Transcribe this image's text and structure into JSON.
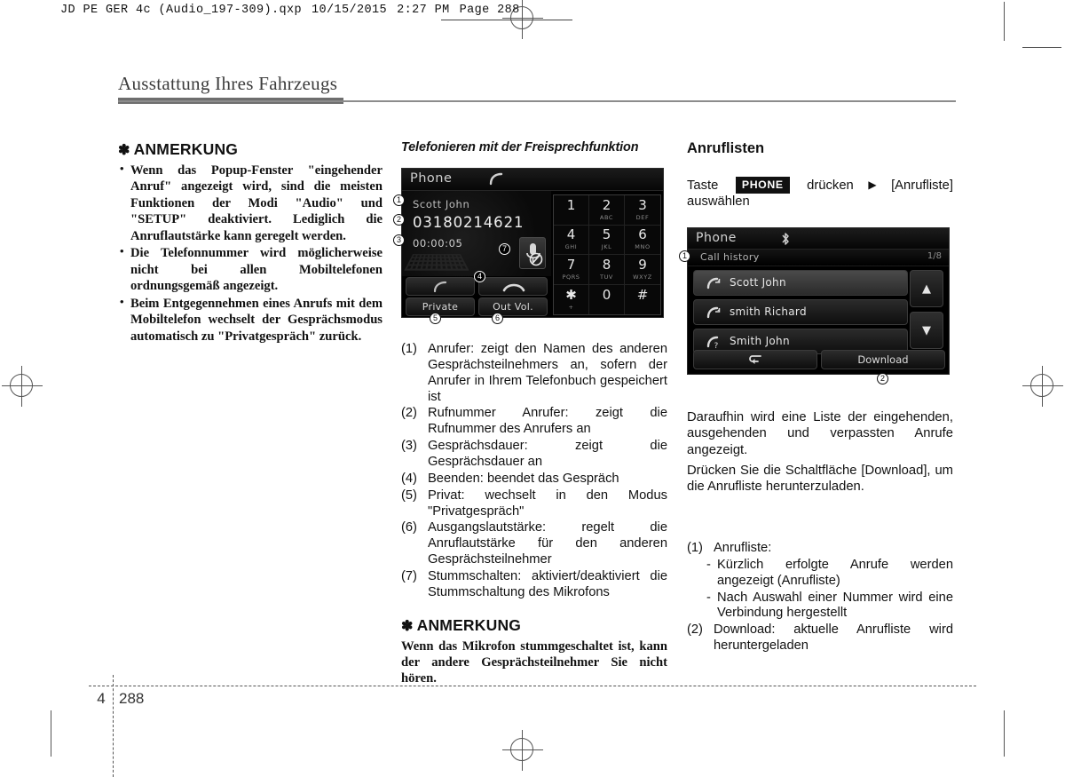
{
  "print_header": {
    "file": "JD PE GER 4c (Audio_197-309).qxp",
    "date": "10/15/2015",
    "time": "2:27 PM",
    "page_label": "Page 288"
  },
  "chapter": {
    "title": "Ausstattung Ihres Fahrzeugs"
  },
  "footer": {
    "chapter_number": "4",
    "page_number": "288"
  },
  "left_column": {
    "note_title": "ANMERKUNG",
    "asterisk": "✽",
    "bullets": [
      "Wenn das Popup-Fenster \"eingehender Anruf\" angezeigt wird, sind die meisten Funktionen der Modi \"Audio\" und \"SETUP\" deaktiviert. Lediglich die Anruflautstärke kann geregelt werden.",
      "Die Telefonnummer wird möglicherweise nicht bei allen Mobiltelefonen ordnungsgemäß angezeigt.",
      "Beim Entgegennehmen eines Anrufs mit dem Mobiltelefon wechselt der Gesprächsmodus automatisch zu \"Privatgespräch\" zurück."
    ]
  },
  "middle_column": {
    "caption": "Telefonieren mit der Freisprechfunktion",
    "call_screen": {
      "title": "Phone",
      "handset_icon": "handset-icon",
      "caller_name": "Scott John",
      "caller_number": "03180214621",
      "call_duration": "00:00:05",
      "buttons": {
        "answer_label": "",
        "end_label": "",
        "private_label": "Private",
        "out_vol_label": "Out Vol."
      },
      "keypad": [
        {
          "digit": "1",
          "sub": ""
        },
        {
          "digit": "2",
          "sub": "ABC"
        },
        {
          "digit": "3",
          "sub": "DEF"
        },
        {
          "digit": "4",
          "sub": "GHI"
        },
        {
          "digit": "5",
          "sub": "JKL"
        },
        {
          "digit": "6",
          "sub": "MNO"
        },
        {
          "digit": "7",
          "sub": "PQRS"
        },
        {
          "digit": "8",
          "sub": "TUV"
        },
        {
          "digit": "9",
          "sub": "WXYZ"
        },
        {
          "digit": "✱",
          "sub": "+"
        },
        {
          "digit": "0",
          "sub": ""
        },
        {
          "digit": "#",
          "sub": ""
        }
      ],
      "callouts": [
        "1",
        "2",
        "3",
        "4",
        "5",
        "6",
        "7"
      ]
    },
    "legend": [
      {
        "num": "(1)",
        "text": "Anrufer: zeigt den Namen des anderen Gesprächsteilnehmers an, sofern der Anrufer in Ihrem Telefonbuch gespeichert ist"
      },
      {
        "num": "(2)",
        "text": "Rufnummer Anrufer: zeigt die Rufnummer des Anrufers an"
      },
      {
        "num": "(3)",
        "text": "Gesprächsdauer: zeigt die Gesprächsdauer an"
      },
      {
        "num": "(4)",
        "text": "Beenden: beendet das Gespräch"
      },
      {
        "num": "(5)",
        "text": "Privat: wechselt in den Modus \"Privatgespräch\""
      },
      {
        "num": "(6)",
        "text": "Ausgangslautstärke: regelt die Anruflautstärke für den anderen Gesprächsteilnehmer"
      },
      {
        "num": "(7)",
        "text": "Stummschalten: aktiviert/deaktiviert die Stummschaltung des Mikrofons"
      }
    ],
    "note_title": "ANMERKUNG",
    "asterisk": "✽",
    "note_text": "Wenn das Mikrofon stummgeschaltet ist, kann der andere Gesprächsteilnehmer Sie nicht hören."
  },
  "right_column": {
    "heading": "Anruflisten",
    "instruction_pre": "Taste",
    "instruction_key": "PHONE",
    "instruction_mid": "drücken",
    "instruction_arrow": "▶",
    "instruction_post": "[Anrufliste] auswählen",
    "history_screen": {
      "title": "Phone",
      "bluetooth_icon": "bluetooth-icon",
      "subtitle": "Call history",
      "page_indicator": "1/8",
      "rows": [
        {
          "name": "Scott John",
          "call_type": "incoming-call-icon",
          "selected": true
        },
        {
          "name": "smith Richard",
          "call_type": "outgoing-call-icon",
          "selected": false
        },
        {
          "name": "Smith John",
          "call_type": "missed-call-icon",
          "selected": false
        }
      ],
      "scroll_up": "▲",
      "scroll_down": "▼",
      "back_label": "↰",
      "download_label": "Download",
      "callouts": [
        "1",
        "2"
      ]
    },
    "paragraphs": [
      "Daraufhin wird eine Liste der eingehenden, ausgehenden und verpassten Anrufe angezeigt.",
      "Drücken Sie die Schaltfläche [Download], um die Anrufliste herunterzuladen."
    ],
    "legend": [
      {
        "num": "(1)",
        "text": "Anrufliste:",
        "subs": [
          "Kürzlich erfolgte Anrufe werden angezeigt (Anrufliste)",
          "Nach Auswahl einer Nummer wird eine Verbindung hergestellt"
        ]
      },
      {
        "num": "(2)",
        "text": "Download: aktuelle Anrufliste wird heruntergeladen",
        "subs": []
      }
    ]
  },
  "colors": {
    "title_gray": "#6e6e6e",
    "text_black": "#111111",
    "screen_black": "#000000"
  }
}
